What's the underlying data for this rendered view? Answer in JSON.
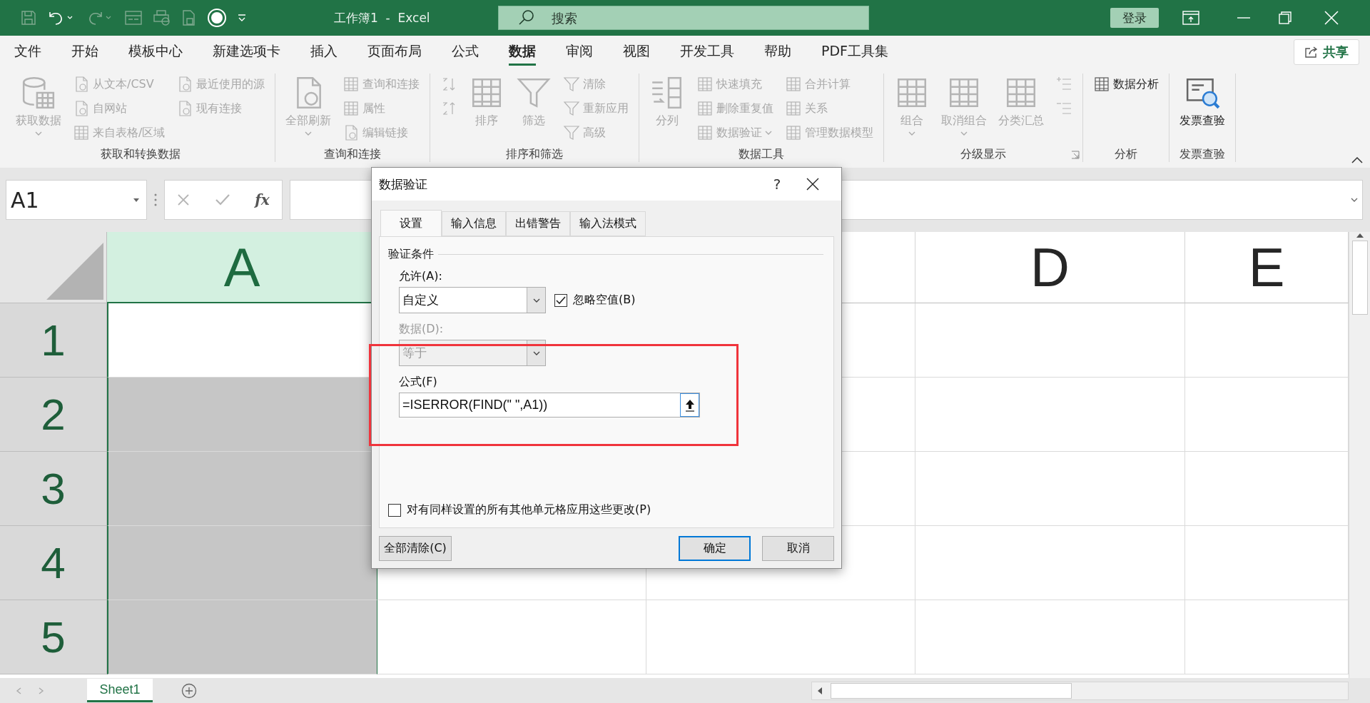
{
  "title_bar": {
    "title": "工作簿1  -  Excel",
    "search": {
      "placeholder": "搜索"
    },
    "login": "登录"
  },
  "menu_tabs": [
    {
      "label": "文件",
      "selected": false
    },
    {
      "label": "开始",
      "selected": false
    },
    {
      "label": "模板中心",
      "selected": false
    },
    {
      "label": "新建选项卡",
      "selected": false
    },
    {
      "label": "插入",
      "selected": false
    },
    {
      "label": "页面布局",
      "selected": false
    },
    {
      "label": "公式",
      "selected": false
    },
    {
      "label": "数据",
      "selected": true
    },
    {
      "label": "审阅",
      "selected": false
    },
    {
      "label": "视图",
      "selected": false
    },
    {
      "label": "开发工具",
      "selected": false
    },
    {
      "label": "帮助",
      "selected": false
    },
    {
      "label": "PDF工具集",
      "selected": false
    }
  ],
  "share": "共享",
  "ribbon": {
    "groups": [
      {
        "label": "获取和转换数据",
        "launcher": false,
        "columns": [
          {
            "kind": "large",
            "label": "获取数据",
            "caret": true,
            "disabled": true
          },
          {
            "kind": "stack",
            "items": [
              {
                "label": "从文本/CSV",
                "disabled": true
              },
              {
                "label": "自网站",
                "disabled": true
              },
              {
                "label": "来自表格/区域",
                "disabled": true
              }
            ]
          },
          {
            "kind": "stack",
            "items": [
              {
                "label": "最近使用的源",
                "disabled": true
              },
              {
                "label": "现有连接",
                "disabled": true
              }
            ]
          }
        ]
      },
      {
        "label": "查询和连接",
        "launcher": false,
        "columns": [
          {
            "kind": "large",
            "label": "全部刷新",
            "caret": true,
            "disabled": true
          },
          {
            "kind": "stack",
            "items": [
              {
                "label": "查询和连接",
                "disabled": true
              },
              {
                "label": "属性",
                "disabled": true
              },
              {
                "label": "编辑链接",
                "disabled": true
              }
            ]
          }
        ]
      },
      {
        "label": "排序和筛选",
        "launcher": false,
        "columns": [
          {
            "kind": "stack",
            "items": [
              {
                "disabled": true
              },
              {
                "disabled": true
              }
            ]
          },
          {
            "kind": "large",
            "label": "排序",
            "caret": false,
            "disabled": true
          },
          {
            "kind": "large",
            "label": "筛选",
            "caret": false,
            "disabled": true
          },
          {
            "kind": "stack",
            "items": [
              {
                "label": "清除",
                "disabled": true
              },
              {
                "label": "重新应用",
                "disabled": true
              },
              {
                "label": "高级",
                "disabled": true
              }
            ]
          }
        ]
      },
      {
        "label": "数据工具",
        "launcher": false,
        "columns": [
          {
            "kind": "large",
            "label": "分列",
            "caret": false,
            "disabled": true
          },
          {
            "kind": "stack",
            "items": [
              {
                "label": "快速填充",
                "disabled": true
              },
              {
                "label": "删除重复值",
                "disabled": true
              },
              {
                "label": "数据验证",
                "caret": true,
                "disabled": true
              }
            ]
          },
          {
            "kind": "stack",
            "items": [
              {
                "label": "合并计算",
                "disabled": true
              },
              {
                "label": "关系",
                "disabled": true
              },
              {
                "label": "管理数据模型",
                "disabled": true
              }
            ]
          }
        ]
      },
      {
        "label": "分级显示",
        "launcher": true,
        "columns": [
          {
            "kind": "large",
            "label": "组合",
            "caret": true,
            "disabled": true
          },
          {
            "kind": "large",
            "label": "取消组合",
            "caret": true,
            "disabled": true
          },
          {
            "kind": "large",
            "label": "分类汇总",
            "caret": false,
            "disabled": true
          },
          {
            "kind": "stack",
            "items": [
              {
                "disabled": true
              },
              {
                "disabled": true
              }
            ]
          }
        ]
      },
      {
        "label": "分析",
        "launcher": false,
        "columns": [
          {
            "kind": "stack",
            "items": [
              {
                "label": "数据分析",
                "disabled": false
              }
            ]
          }
        ]
      },
      {
        "label": "发票查验",
        "launcher": false,
        "columns": [
          {
            "kind": "large",
            "label": "发票查验",
            "caret": false,
            "disabled": false
          }
        ]
      }
    ]
  },
  "formula_bar": {
    "name_box": "A1",
    "function_label": "fx"
  },
  "sheet": {
    "columns": [
      {
        "label": "A",
        "selected": true
      },
      {},
      {},
      {
        "label": "D",
        "selected": false
      },
      {
        "label": "E",
        "selected": false
      }
    ],
    "rows": [
      {
        "label": "1",
        "active": true
      },
      {
        "label": "2",
        "active": false
      },
      {
        "label": "3",
        "active": false
      },
      {
        "label": "4",
        "active": false
      },
      {
        "label": "5",
        "active": false
      }
    ]
  },
  "sheet_tabs": [
    {
      "label": "Sheet1",
      "selected": true
    }
  ],
  "dialog": {
    "title": "数据验证",
    "help": "?",
    "tabs": [
      {
        "label": "设置",
        "selected": true
      },
      {
        "label": "输入信息",
        "selected": false
      },
      {
        "label": "出错警告",
        "selected": false
      },
      {
        "label": "输入法模式",
        "selected": false
      }
    ],
    "section": "验证条件",
    "allow": {
      "label": "允许(A):",
      "value": "自定义"
    },
    "ignore_blank": {
      "label": "忽略空值(B)",
      "checked": true
    },
    "data": {
      "label": "数据(D):",
      "value": "等于",
      "disabled": true
    },
    "formula": {
      "label": "公式(F)",
      "value": "=ISERROR(FIND(\" \",A1))"
    },
    "apply_all": {
      "label": "对有同样设置的所有其他单元格应用这些更改(P)",
      "checked": false
    },
    "buttons": [
      {
        "label": "全部清除(C)",
        "default": false
      },
      {
        "label": "确定",
        "default": true
      },
      {
        "label": "取消",
        "default": false
      }
    ]
  }
}
